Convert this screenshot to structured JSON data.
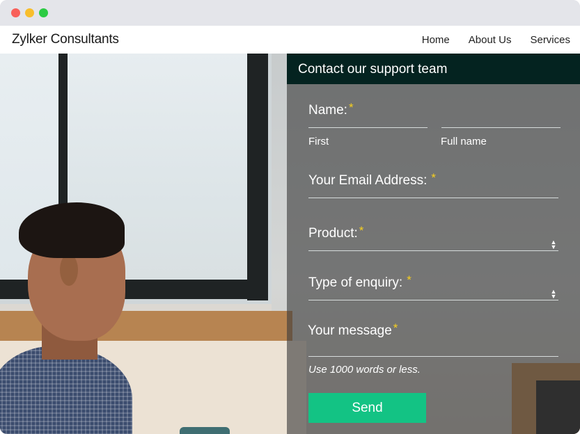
{
  "window": {
    "controls": [
      "close",
      "minimize",
      "maximize"
    ]
  },
  "brand": "Zylker Consultants",
  "nav": {
    "items": [
      "Home",
      "About Us",
      "Services"
    ]
  },
  "form": {
    "title": "Contact our support team",
    "name_label": "Name:",
    "first_label": "First",
    "full_name_label": "Full name",
    "email_label": "Your Email Address:",
    "product_label": "Product:",
    "enquiry_label": "Type of enquiry:",
    "message_label": "Your message",
    "message_hint": "Use 1000 words or less.",
    "required_mark": "*",
    "send_label": "Send"
  },
  "colors": {
    "header_bg": "#042320",
    "send_button": "#13c384",
    "required_asterisk": "#f6cf1f"
  }
}
